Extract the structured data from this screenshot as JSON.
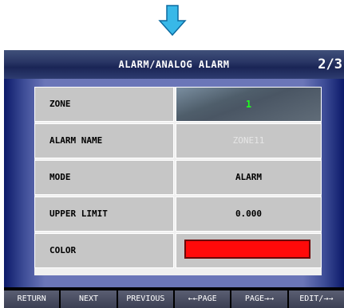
{
  "header": {
    "title": "ALARM/ANALOG ALARM",
    "page_indicator": "2/3"
  },
  "rows": [
    {
      "label": "ZONE",
      "value": "1"
    },
    {
      "label": "ALARM NAME",
      "value": "ZONE11"
    },
    {
      "label": "MODE",
      "value": "ALARM"
    },
    {
      "label": "UPPER LIMIT",
      "value": "0.000"
    },
    {
      "label": "COLOR",
      "value_color": "#ff0a0a"
    }
  ],
  "toolbar": {
    "buttons": [
      "RETURN",
      "NEXT",
      "PREVIOUS",
      "←←PAGE",
      "PAGE→→",
      "EDIT/→→"
    ]
  },
  "colors": {
    "arrow": "#38b8e8",
    "zone_value_text": "#1fff1f",
    "color_swatch": "#ff0a0a"
  },
  "icons": {
    "down_arrow": "down-arrow-icon"
  }
}
